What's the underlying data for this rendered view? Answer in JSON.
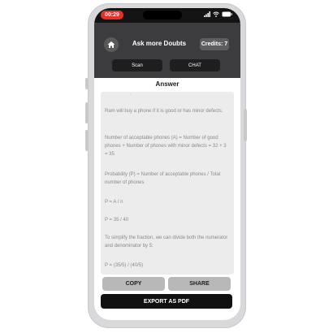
{
  "status": {
    "time": "00:29"
  },
  "header": {
    "title": "Ask more Doubts",
    "credits": "Credits: 7"
  },
  "tabs": [
    {
      "label": "Scan"
    },
    {
      "label": "CHAT"
    }
  ],
  "answer": {
    "heading": "Answer",
    "paragraphs": [
      "Ram will buy a phone if it is good or has minor defects.",
      "Number of acceptable phones (A) = Number of good phones + Number of phones with minor defects = 32 + 3 = 35",
      "Probability (P) = Number of acceptable phones / Total number of phones",
      "P = A / n",
      "P = 35 / 40",
      "To simplify the fraction, we can divide both the numerator and denominator by 5:",
      "P = (35/5) / (40/5)"
    ]
  },
  "actions": {
    "copy": "COPY",
    "share": "SHARE",
    "export": "EXPORT AS PDF"
  }
}
